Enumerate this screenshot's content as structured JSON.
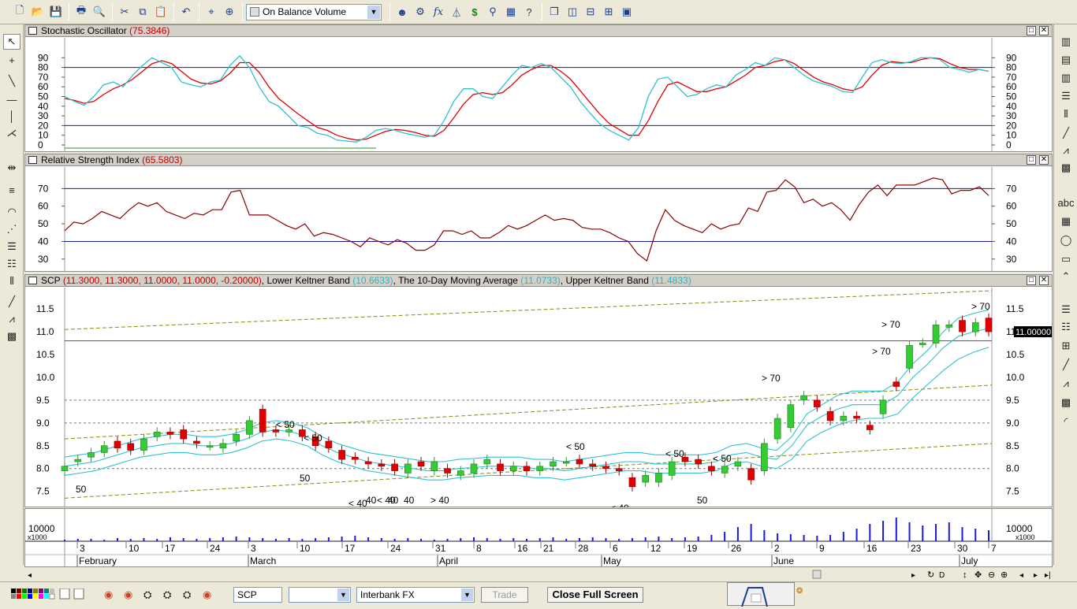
{
  "toolbar": {
    "indicator_select": "On Balance Volume"
  },
  "panes": {
    "stochastic": {
      "name": "Stochastic Oscillator",
      "value": "(75.3846)",
      "yticks": [
        "90",
        "80",
        "70",
        "60",
        "50",
        "40",
        "30",
        "20",
        "10",
        "0"
      ]
    },
    "rsi": {
      "name": "Relative Strength Index",
      "value": "(65.5803)",
      "yticks": [
        "70",
        "60",
        "50",
        "40",
        "30"
      ]
    },
    "price": {
      "symbol": "SCP",
      "ohlc": "(11.3000, 11.3000, 11.0000, 11.0000, -0.20000)",
      "sep1": ",",
      "lower_name": "Lower Keltner Band",
      "lower_value": "(10.6633)",
      "ma_name": "The 10-Day Moving Average",
      "ma_value": "(11.0733)",
      "upper_name": "Upper Keltner Band",
      "upper_value": "(11.4833)",
      "yticks": [
        "11.5",
        "11.0",
        "10.5",
        "10.0",
        "9.5",
        "9.0",
        "8.5",
        "8.0",
        "7.5"
      ],
      "last_price": "11.00000",
      "annotations": [
        "50",
        "< 50",
        "< 50",
        "50",
        "< 40",
        "40",
        "< 40",
        "40",
        "40",
        "> 40",
        "< 50",
        "< 40",
        "< 50",
        "< 50",
        "50",
        "> 70",
        "> 70",
        "> 70",
        "> 70"
      ]
    },
    "volume": {
      "ytick": "10000",
      "multiplier": "x1000"
    }
  },
  "dates": {
    "days": [
      "3",
      "10",
      "17",
      "24",
      "3",
      "10",
      "17",
      "24",
      "31",
      "8",
      "16",
      "21",
      "28",
      "6",
      "12",
      "19",
      "26",
      "2",
      "9",
      "16",
      "23",
      "30",
      "7"
    ],
    "months": [
      "February",
      "March",
      "April",
      "May",
      "June",
      "July"
    ]
  },
  "statusbar": {
    "symbol": "SCP",
    "blank_select": "",
    "market": "Interbank FX",
    "trade_label": "Trade",
    "close_label": "Close Full Screen"
  },
  "colors": {
    "stoch_k": "#e00000",
    "stoch_d": "#30c0d0",
    "rsi": "#8b0000",
    "keltner": "#2ec3cf",
    "up_candle": "#33cc33",
    "down_candle": "#e00000",
    "volume": "#1a1ad8"
  },
  "chart_data": [
    {
      "type": "line",
      "title": "Stochastic Oscillator",
      "ylim": [
        0,
        100
      ],
      "reference_lines": [
        20,
        80
      ],
      "series": [
        {
          "values": [
            50,
            45,
            41,
            50,
            62,
            65,
            60,
            72,
            82,
            90,
            85,
            80,
            65,
            62,
            60,
            65,
            67,
            82,
            92,
            80,
            60,
            45,
            40,
            30,
            20,
            18,
            12,
            10,
            5,
            4,
            3,
            8,
            15,
            17,
            15,
            12,
            10,
            8,
            10,
            25,
            45,
            58,
            58,
            50,
            48,
            60,
            72,
            82,
            80,
            84,
            80,
            70,
            60,
            45,
            33,
            22,
            15,
            10,
            5,
            18,
            50,
            68,
            70,
            60,
            50,
            52,
            58,
            62,
            60,
            72,
            78,
            85,
            82,
            90,
            88,
            80,
            72,
            66,
            63,
            60,
            55,
            54,
            70,
            85,
            88,
            85,
            84,
            86,
            90,
            90,
            88,
            80,
            78,
            75,
            78,
            76
          ]
        },
        {
          "values": [
            48,
            46,
            43,
            45,
            52,
            58,
            62,
            68,
            76,
            84,
            87,
            84,
            76,
            68,
            64,
            63,
            66,
            74,
            85,
            85,
            75,
            60,
            48,
            40,
            32,
            25,
            18,
            15,
            10,
            7,
            5,
            6,
            10,
            14,
            16,
            15,
            13,
            10,
            9,
            15,
            28,
            42,
            52,
            54,
            52,
            54,
            62,
            72,
            78,
            82,
            82,
            76,
            68,
            56,
            44,
            32,
            22,
            16,
            10,
            10,
            25,
            45,
            62,
            65,
            60,
            55,
            55,
            58,
            60,
            66,
            72,
            80,
            82,
            86,
            88,
            84,
            77,
            70,
            65,
            62,
            58,
            56,
            60,
            72,
            82,
            86,
            85,
            85,
            88,
            90,
            89,
            84,
            80,
            78,
            78,
            76
          ]
        }
      ]
    },
    {
      "type": "line",
      "title": "Relative Strength Index",
      "ylim": [
        25,
        80
      ],
      "reference_lines": [
        40,
        70
      ],
      "series": [
        {
          "values": [
            46,
            51,
            50,
            53,
            57,
            55,
            53,
            58,
            62,
            60,
            62,
            57,
            55,
            53,
            56,
            55,
            58,
            58,
            68,
            69,
            55,
            55,
            55,
            52,
            49,
            47,
            50,
            43,
            45,
            44,
            42,
            40,
            37,
            42,
            40,
            38,
            41,
            39,
            35,
            35,
            38,
            46,
            46,
            44,
            46,
            42,
            42,
            45,
            49,
            47,
            49,
            52,
            55,
            52,
            53,
            52,
            48,
            47,
            47,
            45,
            42,
            40,
            33,
            29,
            46,
            58,
            52,
            49,
            47,
            45,
            50,
            47,
            49,
            50,
            59,
            57,
            68,
            69,
            75,
            71,
            62,
            64,
            60,
            62,
            58,
            52,
            61,
            68,
            72,
            66,
            72,
            72,
            72,
            74,
            76,
            75,
            67,
            69,
            69,
            71,
            66
          ]
        }
      ]
    },
    {
      "type": "candlestick",
      "title": "SCP",
      "ylim": [
        7.2,
        11.9
      ],
      "series": [
        {
          "name": "Upper Keltner Band",
          "values": [
            8.25,
            8.3,
            8.35,
            8.45,
            8.55,
            8.65,
            8.7,
            8.75,
            8.75,
            8.7,
            8.7,
            8.75,
            8.85,
            9.0,
            9.05,
            9.0,
            8.9,
            8.7,
            8.55,
            8.45,
            8.35,
            8.3,
            8.25,
            8.2,
            8.15,
            8.15,
            8.2,
            8.22,
            8.25,
            8.25,
            8.25,
            8.2,
            8.2,
            8.15,
            8.2,
            8.25,
            8.3,
            8.35,
            8.35,
            8.3,
            8.3,
            8.3,
            8.3,
            8.35,
            8.5,
            8.55,
            8.45,
            8.4,
            8.7,
            9.2,
            9.4,
            9.6,
            9.7,
            9.7,
            9.7,
            9.9,
            10.3,
            10.6,
            11.0,
            11.3,
            11.4,
            11.48
          ]
        },
        {
          "name": "The 10-Day Moving Average",
          "values": [
            8.05,
            8.1,
            8.15,
            8.25,
            8.35,
            8.45,
            8.5,
            8.55,
            8.55,
            8.5,
            8.5,
            8.55,
            8.65,
            8.8,
            8.85,
            8.8,
            8.7,
            8.5,
            8.35,
            8.25,
            8.15,
            8.1,
            8.05,
            8.0,
            7.95,
            7.95,
            8.0,
            8.02,
            8.05,
            8.05,
            8.05,
            8.0,
            8.0,
            7.95,
            8.0,
            8.05,
            8.1,
            8.15,
            8.15,
            8.1,
            8.1,
            8.1,
            8.1,
            8.15,
            8.3,
            8.35,
            8.25,
            8.2,
            8.5,
            8.95,
            9.15,
            9.3,
            9.4,
            9.4,
            9.4,
            9.6,
            10.0,
            10.3,
            10.65,
            10.9,
            11.0,
            11.07
          ]
        },
        {
          "name": "Lower Keltner Band",
          "values": [
            7.85,
            7.9,
            7.95,
            8.05,
            8.15,
            8.25,
            8.3,
            8.35,
            8.35,
            8.3,
            8.3,
            8.35,
            8.45,
            8.6,
            8.65,
            8.6,
            8.5,
            8.3,
            8.15,
            8.05,
            7.95,
            7.9,
            7.85,
            7.8,
            7.75,
            7.75,
            7.8,
            7.82,
            7.85,
            7.85,
            7.85,
            7.8,
            7.8,
            7.75,
            7.8,
            7.85,
            7.9,
            7.95,
            7.95,
            7.9,
            7.9,
            7.9,
            7.9,
            7.95,
            8.1,
            8.15,
            8.05,
            8.0,
            8.2,
            8.6,
            8.8,
            8.95,
            9.05,
            9.1,
            9.1,
            9.2,
            9.55,
            9.85,
            10.15,
            10.4,
            10.55,
            10.66
          ]
        }
      ],
      "candles": [
        [
          7.95,
          8.05
        ],
        [
          8.15,
          8.2
        ],
        [
          8.25,
          8.35
        ],
        [
          8.35,
          8.5
        ],
        [
          8.6,
          8.45
        ],
        [
          8.55,
          8.4
        ],
        [
          8.4,
          8.65
        ],
        [
          8.7,
          8.8
        ],
        [
          8.8,
          8.75
        ],
        [
          8.85,
          8.65
        ],
        [
          8.6,
          8.55
        ],
        [
          8.5,
          8.5
        ],
        [
          8.45,
          8.55
        ],
        [
          8.6,
          8.75
        ],
        [
          8.75,
          9.05
        ],
        [
          9.3,
          8.8
        ],
        [
          8.85,
          8.8
        ],
        [
          8.8,
          8.85
        ],
        [
          8.85,
          8.7
        ],
        [
          8.7,
          8.5
        ],
        [
          8.6,
          8.45
        ],
        [
          8.4,
          8.2
        ],
        [
          8.25,
          8.2
        ],
        [
          8.15,
          8.1
        ],
        [
          8.1,
          8.05
        ],
        [
          8.1,
          7.95
        ],
        [
          7.9,
          8.1
        ],
        [
          8.15,
          8.05
        ],
        [
          7.95,
          8.15
        ],
        [
          8.0,
          7.9
        ],
        [
          7.85,
          7.95
        ],
        [
          7.9,
          8.1
        ],
        [
          8.1,
          8.2
        ],
        [
          8.1,
          7.95
        ],
        [
          7.95,
          8.05
        ],
        [
          8.05,
          7.95
        ],
        [
          7.95,
          8.05
        ],
        [
          8.05,
          8.15
        ],
        [
          8.15,
          8.15
        ],
        [
          8.2,
          8.1
        ],
        [
          8.1,
          8.05
        ],
        [
          8.05,
          8.0
        ],
        [
          8.0,
          7.95
        ],
        [
          7.8,
          7.6
        ],
        [
          7.7,
          7.85
        ],
        [
          7.7,
          7.9
        ],
        [
          7.85,
          8.15
        ],
        [
          8.25,
          8.15
        ],
        [
          8.2,
          8.1
        ],
        [
          8.05,
          7.95
        ],
        [
          7.9,
          8.05
        ],
        [
          8.05,
          8.15
        ],
        [
          8.0,
          7.75
        ],
        [
          7.95,
          8.55
        ],
        [
          8.65,
          9.1
        ],
        [
          8.9,
          9.4
        ],
        [
          9.5,
          9.6
        ],
        [
          9.5,
          9.35
        ],
        [
          9.25,
          9.05
        ],
        [
          9.05,
          9.15
        ],
        [
          9.15,
          9.1
        ],
        [
          8.95,
          8.85
        ],
        [
          9.2,
          9.5
        ],
        [
          9.9,
          9.8
        ],
        [
          10.2,
          10.7
        ],
        [
          10.75,
          10.75
        ],
        [
          10.75,
          11.15
        ],
        [
          11.1,
          11.15
        ],
        [
          11.25,
          11.0
        ],
        [
          11.0,
          11.2
        ],
        [
          11.3,
          11.0
        ]
      ]
    },
    {
      "type": "bar",
      "title": "Volume",
      "ylim": [
        0,
        30000
      ]
    }
  ]
}
